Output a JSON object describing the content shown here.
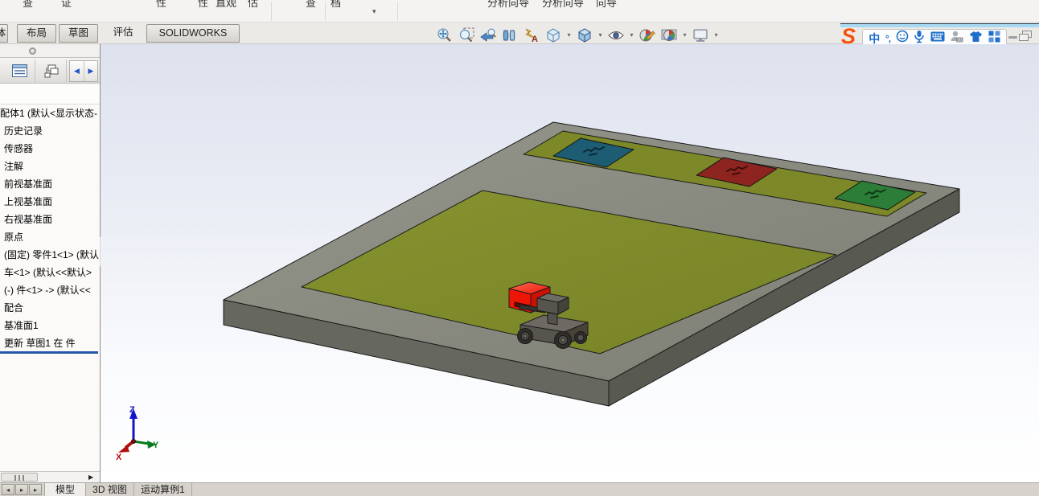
{
  "ribbon": {
    "fragments": [
      "查",
      "证",
      "性",
      "性",
      "直观",
      "估",
      "查",
      "档",
      "分析向导",
      "分析向导",
      "向导"
    ],
    "caret": "▾"
  },
  "command_tabs": {
    "partial_tab": "体",
    "tabs": [
      {
        "label": "布局"
      },
      {
        "label": "草图"
      },
      {
        "label": "评估"
      },
      {
        "label": "SOLIDWORKS MBD"
      }
    ],
    "active": "评估"
  },
  "headsup": {
    "icons": [
      "zoom-to-fit",
      "zoom-to-area",
      "previous-view",
      "section-view",
      "dynamic-annotation-views",
      "view-orientation",
      "display-style",
      "hide-show-items",
      "edit-appearance",
      "apply-scene",
      "view-settings"
    ],
    "caret": "▾"
  },
  "ime": {
    "logo": "S",
    "mode": "中",
    "punctuation": "°,",
    "badge": "20",
    "icons": [
      "sogou-logo",
      "chinese-mode",
      "punctuation",
      "emoji-face",
      "microphone",
      "keyboard",
      "signin-person",
      "skin-shirt",
      "toolbox-grid"
    ]
  },
  "window": {
    "minimize": "—",
    "restore": "restore-window"
  },
  "panel": {
    "tree": [
      "配体1 (默认<显示状态-",
      "历史记录",
      "传感器",
      "注解",
      "前视基准面",
      "上视基准面",
      "右视基准面",
      "原点",
      "(固定) 零件1<1> (默认",
      "车<1> (默认<<默认>",
      "(-) 件<1> -> (默认<<",
      "配合",
      "基准面1",
      "更新 草图1 在 件"
    ]
  },
  "viewport": {
    "triad": {
      "x": "X",
      "y": "Y",
      "z": "Z"
    }
  },
  "bottom": {
    "nav": [
      "◂",
      "▸",
      "▸"
    ],
    "tabs": [
      {
        "label": "模型"
      },
      {
        "label": "3D 视图"
      },
      {
        "label": "运动算例1"
      }
    ],
    "active": "模型"
  },
  "colors": {
    "plate_top": "#8a8b80",
    "plate_side_left": "#66675e",
    "plate_side_right": "#585951",
    "green_surface": "#7e8a2a",
    "square_blue": "#1e5c74",
    "square_red": "#8e2420",
    "square_green": "#2b7d37",
    "robot_red": "#ee1606",
    "rollback_blue": "#2456a8",
    "viewport_top": "#dde2ee",
    "viewport_bottom": "#ffffff"
  }
}
